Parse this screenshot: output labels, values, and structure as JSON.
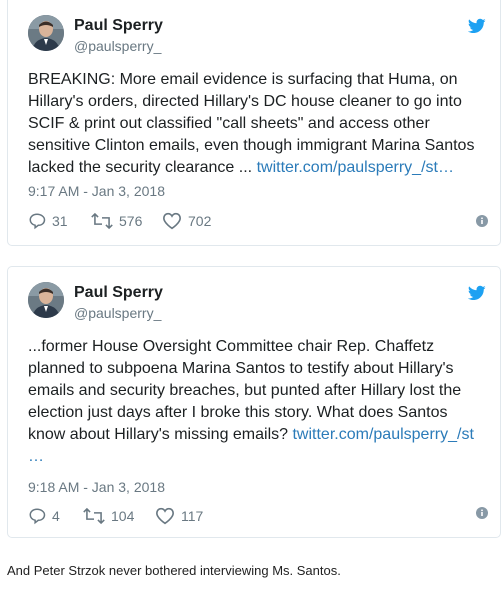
{
  "tweets": [
    {
      "name": "Paul Sperry",
      "handle": "@paulsperry_",
      "text": "BREAKING: More email evidence is surfacing that Huma, on Hillary's orders, directed Hillary's DC house cleaner to go into SCIF & print out classified \"call sheets\" and access other sensitive Clinton emails, even though immigrant Marina Santos lacked the security clearance ... ",
      "link": "twitter.com/paulsperry_/st…",
      "time": "9:17 AM - Jan 3, 2018",
      "replies": "31",
      "retweets": "576",
      "likes": "702"
    },
    {
      "name": "Paul Sperry",
      "handle": "@paulsperry_",
      "text": "...former House Oversight Committee chair Rep. Chaffetz planned to subpoena Marina Santos to testify about Hillary's emails and security breaches, but punted after Hillary lost the election just days after I broke this story. What does Santos know about Hillary's missing emails? ",
      "link": "twitter.com/paulsperry_/st …",
      "time": "9:18 AM - Jan 3, 2018",
      "replies": "4",
      "retweets": "104",
      "likes": "117"
    }
  ],
  "caption": "And Peter Strzok never bothered interviewing Ms. Santos.",
  "colors": {
    "link": "#2b7bb9",
    "twitter_blue": "#1da1f2",
    "meta": "#697882"
  },
  "icons": [
    "twitter-bird-icon",
    "reply-icon",
    "retweet-icon",
    "like-icon",
    "info-icon"
  ]
}
